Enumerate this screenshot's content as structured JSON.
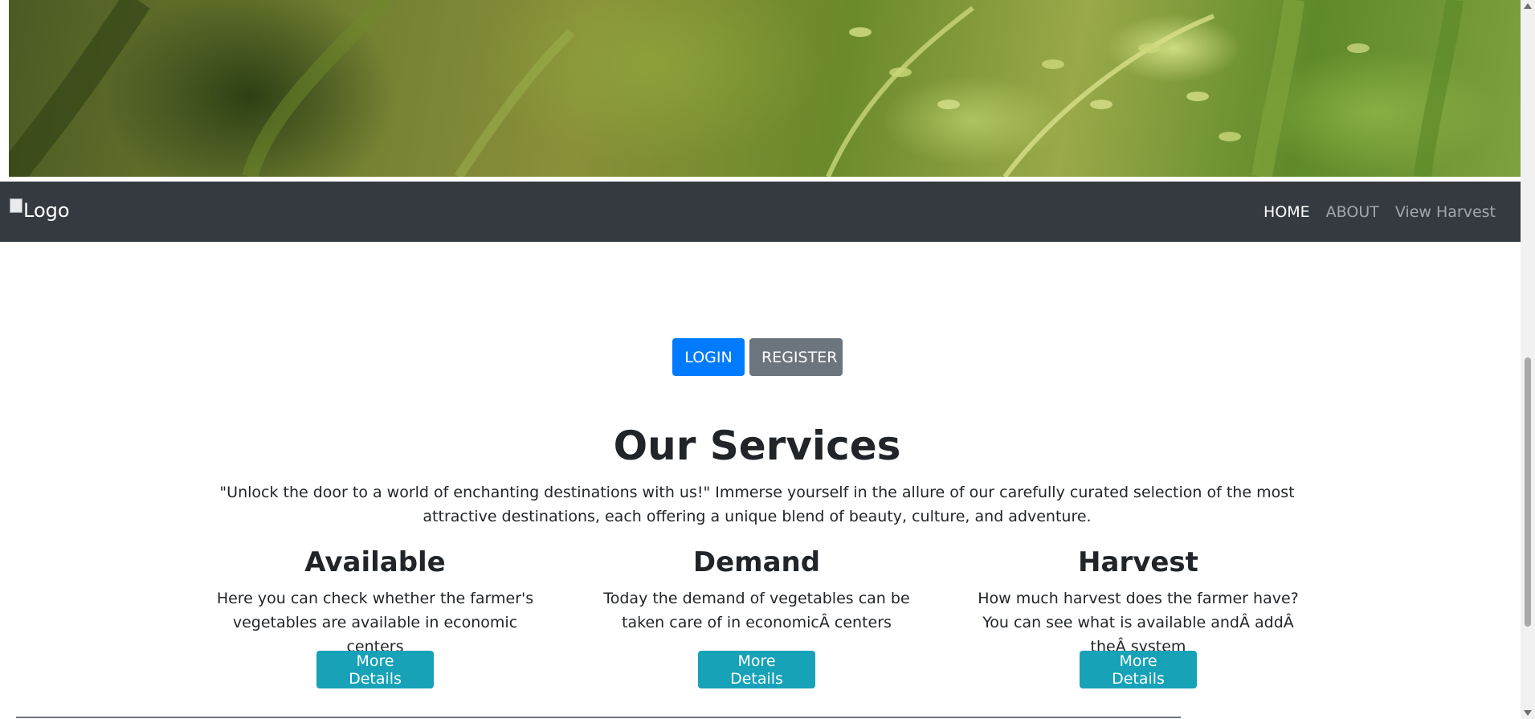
{
  "navbar": {
    "logo_alt": "Logo",
    "links": [
      {
        "label": "HOME",
        "active": true
      },
      {
        "label": "ABOUT",
        "active": false
      },
      {
        "label": "View Harvest",
        "active": false
      }
    ]
  },
  "auth": {
    "login_label": "LOGIN",
    "register_label": "REGISTER"
  },
  "services": {
    "title": "Our Services",
    "description": "\"Unlock the door to a world of enchanting destinations with us!\" Immerse yourself in the allure of our carefully curated selection of the most attractive destinations, each offering a unique blend of beauty, culture, and adventure.",
    "cards": [
      {
        "title": "Available",
        "text": "Here you can check whether the farmer's vegetables are available in economic centers",
        "button": "More Details"
      },
      {
        "title": "Demand",
        "text": "Today the demand of vegetables can be taken care of in economicÂ centers",
        "button": "More Details"
      },
      {
        "title": "Harvest",
        "text": "How much harvest does the farmer have? You can see what is available andÂ addÂ theÂ system",
        "button": "More Details"
      }
    ]
  },
  "colors": {
    "navbar_bg": "#343a40",
    "primary": "#007bff",
    "secondary": "#6c757d",
    "info": "#17a2b8"
  }
}
